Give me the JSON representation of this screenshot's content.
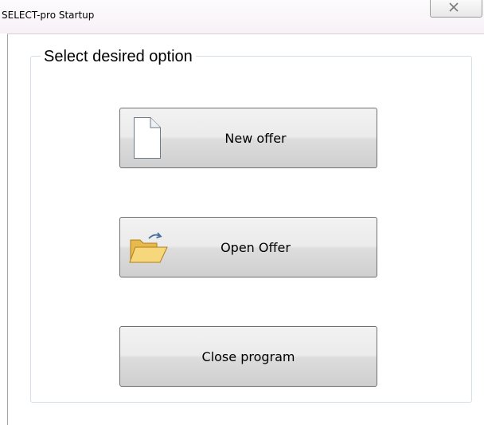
{
  "window": {
    "title": "SELECT-pro  Startup"
  },
  "titlebar": {
    "close_icon": "close-icon"
  },
  "group": {
    "legend": "Select desired option"
  },
  "buttons": {
    "new_offer": {
      "label": "New offer",
      "icon": "blank-document-icon"
    },
    "open_offer": {
      "label": "Open Offer",
      "icon": "open-folder-icon"
    },
    "close_program": {
      "label": "Close program"
    }
  }
}
